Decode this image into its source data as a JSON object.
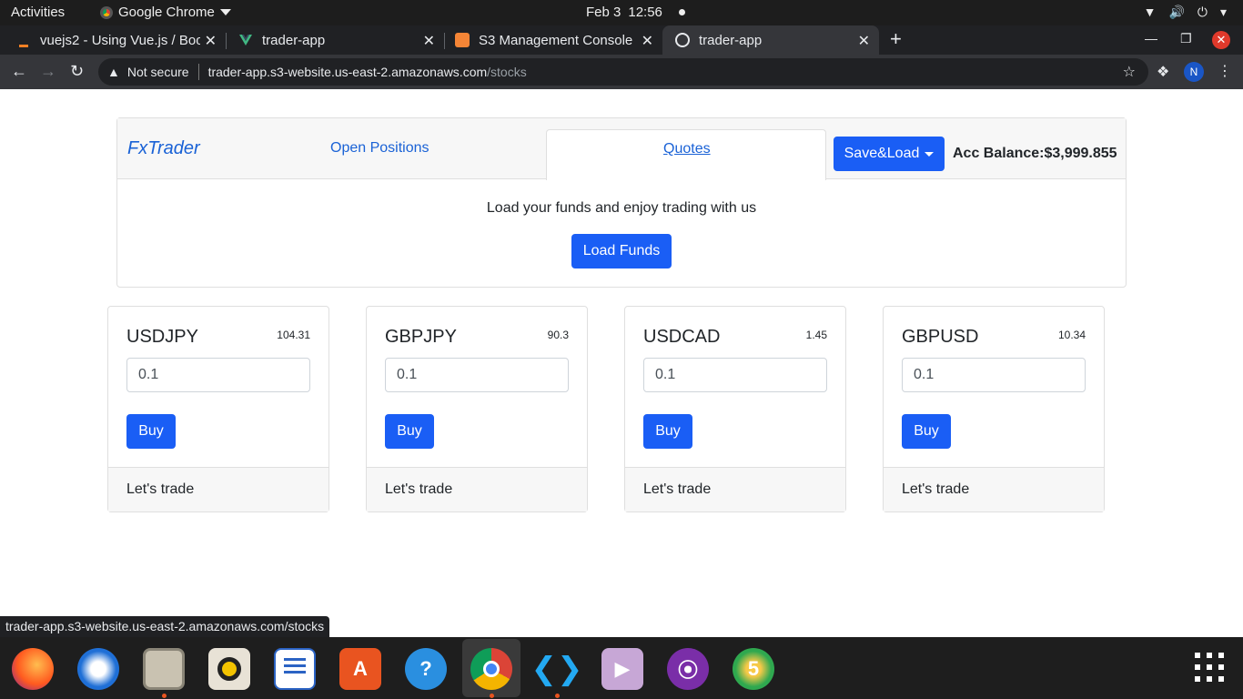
{
  "system": {
    "activities": "Activities",
    "app_name": "Google Chrome",
    "date": "Feb 3",
    "time": "12:56"
  },
  "tabs": [
    {
      "title": "vuejs2 - Using Vue.js / Boo",
      "active": false
    },
    {
      "title": "trader-app",
      "active": false
    },
    {
      "title": "S3 Management Console",
      "active": false
    },
    {
      "title": "trader-app",
      "active": true
    }
  ],
  "addressbar": {
    "security": "Not secure",
    "host": "trader-app.s3-website.us-east-2.amazonaws.com",
    "path": "/stocks",
    "profile_initial": "N"
  },
  "nav": {
    "brand": "FxTrader",
    "open_positions": "Open Positions",
    "quotes": "Quotes",
    "save_load": "Save&Load",
    "balance": "Acc Balance:$3,999.855"
  },
  "banner": {
    "message": "Load your funds and enjoy trading with us",
    "button": "Load Funds"
  },
  "stocks": [
    {
      "name": "USDJPY",
      "price": "104.31",
      "quantity": "0.1",
      "buy": "Buy",
      "footer": "Let's trade"
    },
    {
      "name": "GBPJPY",
      "price": "90.3",
      "quantity": "0.1",
      "buy": "Buy",
      "footer": "Let's trade"
    },
    {
      "name": "USDCAD",
      "price": "1.45",
      "quantity": "0.1",
      "buy": "Buy",
      "footer": "Let's trade"
    },
    {
      "name": "GBPUSD",
      "price": "10.34",
      "quantity": "0.1",
      "buy": "Buy",
      "footer": "Let's trade"
    }
  ],
  "status_bar_url": "trader-app.s3-website.us-east-2.amazonaws.com/stocks",
  "colors": {
    "primary": "#1a5ef5",
    "link": "#1a62d6"
  },
  "dock_icons": [
    "firefox-icon",
    "thunderbird-icon",
    "files-icon",
    "rhythmbox-icon",
    "writer-icon",
    "software-icon",
    "help-icon",
    "chrome-icon",
    "vscode-icon",
    "video-icon",
    "tor-icon",
    "metatrader-icon"
  ]
}
